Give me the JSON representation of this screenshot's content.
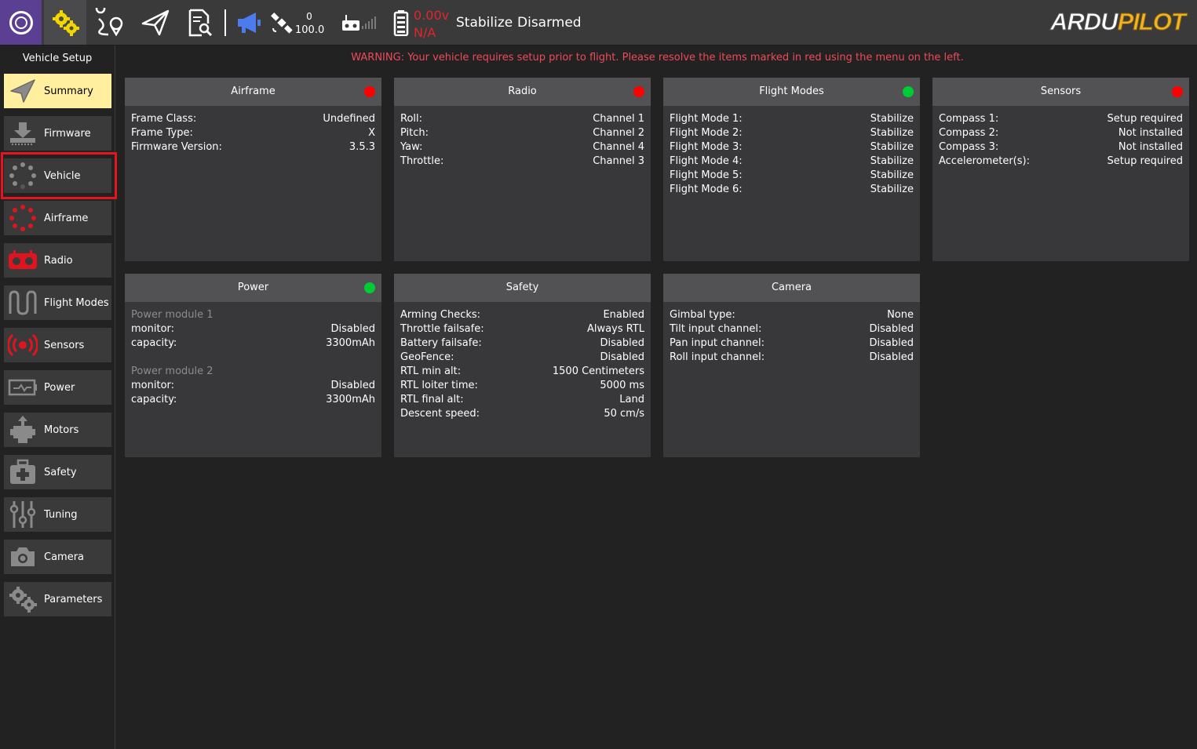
{
  "toolbar": {
    "sat_count": "0",
    "hdop": "100.0",
    "battery_voltage": "0.00v",
    "battery_remaining": "N/A",
    "flight_mode": "Stabilize",
    "arm_status": "Disarmed",
    "brand_part1": "ARDU",
    "brand_part2": "PILOT",
    "alert_color": "#e0252b",
    "accent_color": "#5a3f92"
  },
  "sidebar": {
    "title": "Vehicle Setup",
    "items": [
      {
        "label": "Summary",
        "icon": "paper-plane-icon",
        "active": true
      },
      {
        "label": "Firmware",
        "icon": "download-icon"
      },
      {
        "label": "Vehicle",
        "icon": "vehicle-dots-icon"
      },
      {
        "label": "Airframe",
        "icon": "airframe-icon"
      },
      {
        "label": "Radio",
        "icon": "radio-icon"
      },
      {
        "label": "Flight Modes",
        "icon": "wave-icon"
      },
      {
        "label": "Sensors",
        "icon": "sensors-icon"
      },
      {
        "label": "Power",
        "icon": "battery-icon"
      },
      {
        "label": "Motors",
        "icon": "motor-icon"
      },
      {
        "label": "Safety",
        "icon": "first-aid-icon"
      },
      {
        "label": "Tuning",
        "icon": "sliders-icon"
      },
      {
        "label": "Camera",
        "icon": "camera-icon"
      },
      {
        "label": "Parameters",
        "icon": "gears-icon"
      }
    ]
  },
  "warning": "WARNING: Your vehicle requires setup prior to flight. Please resolve the items marked in red using the menu on the left.",
  "colors": {
    "status_red": "#ff0000",
    "status_green": "#00cc33",
    "warning": "#ef4a5a",
    "active_item": "#ffef9e"
  },
  "cards": {
    "airframe": {
      "title": "Airframe",
      "status": "red",
      "rows": [
        {
          "k": "Frame Class:",
          "v": "Undefined"
        },
        {
          "k": "Frame Type:",
          "v": "X"
        },
        {
          "k": "Firmware Version:",
          "v": "3.5.3"
        }
      ]
    },
    "radio": {
      "title": "Radio",
      "status": "red",
      "rows": [
        {
          "k": "Roll:",
          "v": "Channel 1"
        },
        {
          "k": "Pitch:",
          "v": "Channel 2"
        },
        {
          "k": "Yaw:",
          "v": "Channel 4"
        },
        {
          "k": "Throttle:",
          "v": "Channel 3"
        }
      ]
    },
    "flight_modes": {
      "title": "Flight Modes",
      "status": "green",
      "rows": [
        {
          "k": "Flight Mode 1:",
          "v": "Stabilize"
        },
        {
          "k": "Flight Mode 2:",
          "v": "Stabilize"
        },
        {
          "k": "Flight Mode 3:",
          "v": "Stabilize"
        },
        {
          "k": "Flight Mode 4:",
          "v": "Stabilize"
        },
        {
          "k": "Flight Mode 5:",
          "v": "Stabilize"
        },
        {
          "k": "Flight Mode 6:",
          "v": "Stabilize"
        }
      ]
    },
    "sensors": {
      "title": "Sensors",
      "status": "red",
      "rows": [
        {
          "k": "Compass 1:",
          "v": "Setup required"
        },
        {
          "k": "Compass 2:",
          "v": "Not installed"
        },
        {
          "k": "Compass 3:",
          "v": "Not installed"
        },
        {
          "k": "Accelerometer(s):",
          "v": "Setup required"
        }
      ]
    },
    "power": {
      "title": "Power",
      "status": "green",
      "module1": "Power module 1",
      "module1_rows": [
        {
          "k": "monitor:",
          "v": "Disabled"
        },
        {
          "k": "capacity:",
          "v": "3300mAh"
        }
      ],
      "module2": "Power module 2",
      "module2_rows": [
        {
          "k": "monitor:",
          "v": "Disabled"
        },
        {
          "k": "capacity:",
          "v": "3300mAh"
        }
      ]
    },
    "safety": {
      "title": "Safety",
      "rows": [
        {
          "k": "Arming Checks:",
          "v": "Enabled"
        },
        {
          "k": "Throttle failsafe:",
          "v": "Always RTL"
        },
        {
          "k": "Battery failsafe:",
          "v": "Disabled"
        },
        {
          "k": "GeoFence:",
          "v": "Disabled"
        },
        {
          "k": "RTL min alt:",
          "v": "1500 Centimeters"
        },
        {
          "k": "RTL loiter time:",
          "v": "5000 ms"
        },
        {
          "k": "RTL final alt:",
          "v": "Land"
        },
        {
          "k": "Descent speed:",
          "v": "50 cm/s"
        }
      ]
    },
    "camera": {
      "title": "Camera",
      "rows": [
        {
          "k": "Gimbal type:",
          "v": "None"
        },
        {
          "k": "Tilt input channel:",
          "v": "Disabled"
        },
        {
          "k": "Pan input channel:",
          "v": "Disabled"
        },
        {
          "k": "Roll input channel:",
          "v": "Disabled"
        }
      ]
    }
  }
}
